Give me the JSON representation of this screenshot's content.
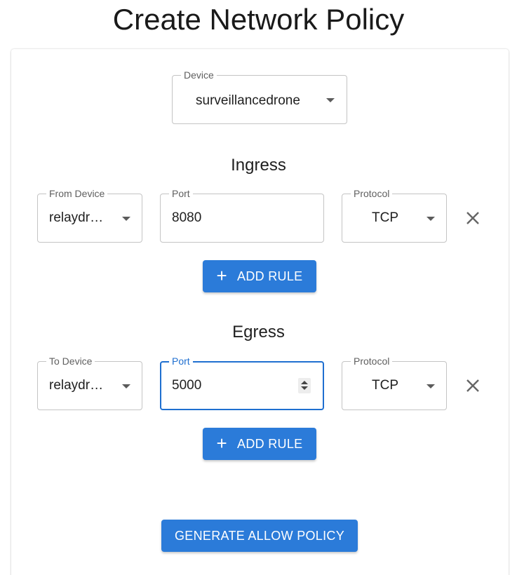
{
  "page": {
    "title": "Create Network Policy"
  },
  "device": {
    "label": "Device",
    "value": "surveillancedrone"
  },
  "ingress": {
    "heading": "Ingress",
    "rule": {
      "device_label": "From Device",
      "device_value": "relaydr…",
      "port_label": "Port",
      "port_value": "8080",
      "protocol_label": "Protocol",
      "protocol_value": "TCP"
    },
    "add_rule_label": "ADD RULE"
  },
  "egress": {
    "heading": "Egress",
    "rule": {
      "device_label": "To Device",
      "device_value": "relaydr…",
      "port_label": "Port",
      "port_value": "5000",
      "protocol_label": "Protocol",
      "protocol_value": "TCP"
    },
    "add_rule_label": "ADD RULE"
  },
  "generate_label": "GENERATE ALLOW POLICY",
  "colors": {
    "accent": "#2b7bd9",
    "focus": "#1f6fd0",
    "border": "#c4c4c4"
  },
  "icons": {
    "dropdown": "chevron-down-icon",
    "remove": "close-icon",
    "add": "plus-icon",
    "stepper": "number-stepper-icon"
  }
}
